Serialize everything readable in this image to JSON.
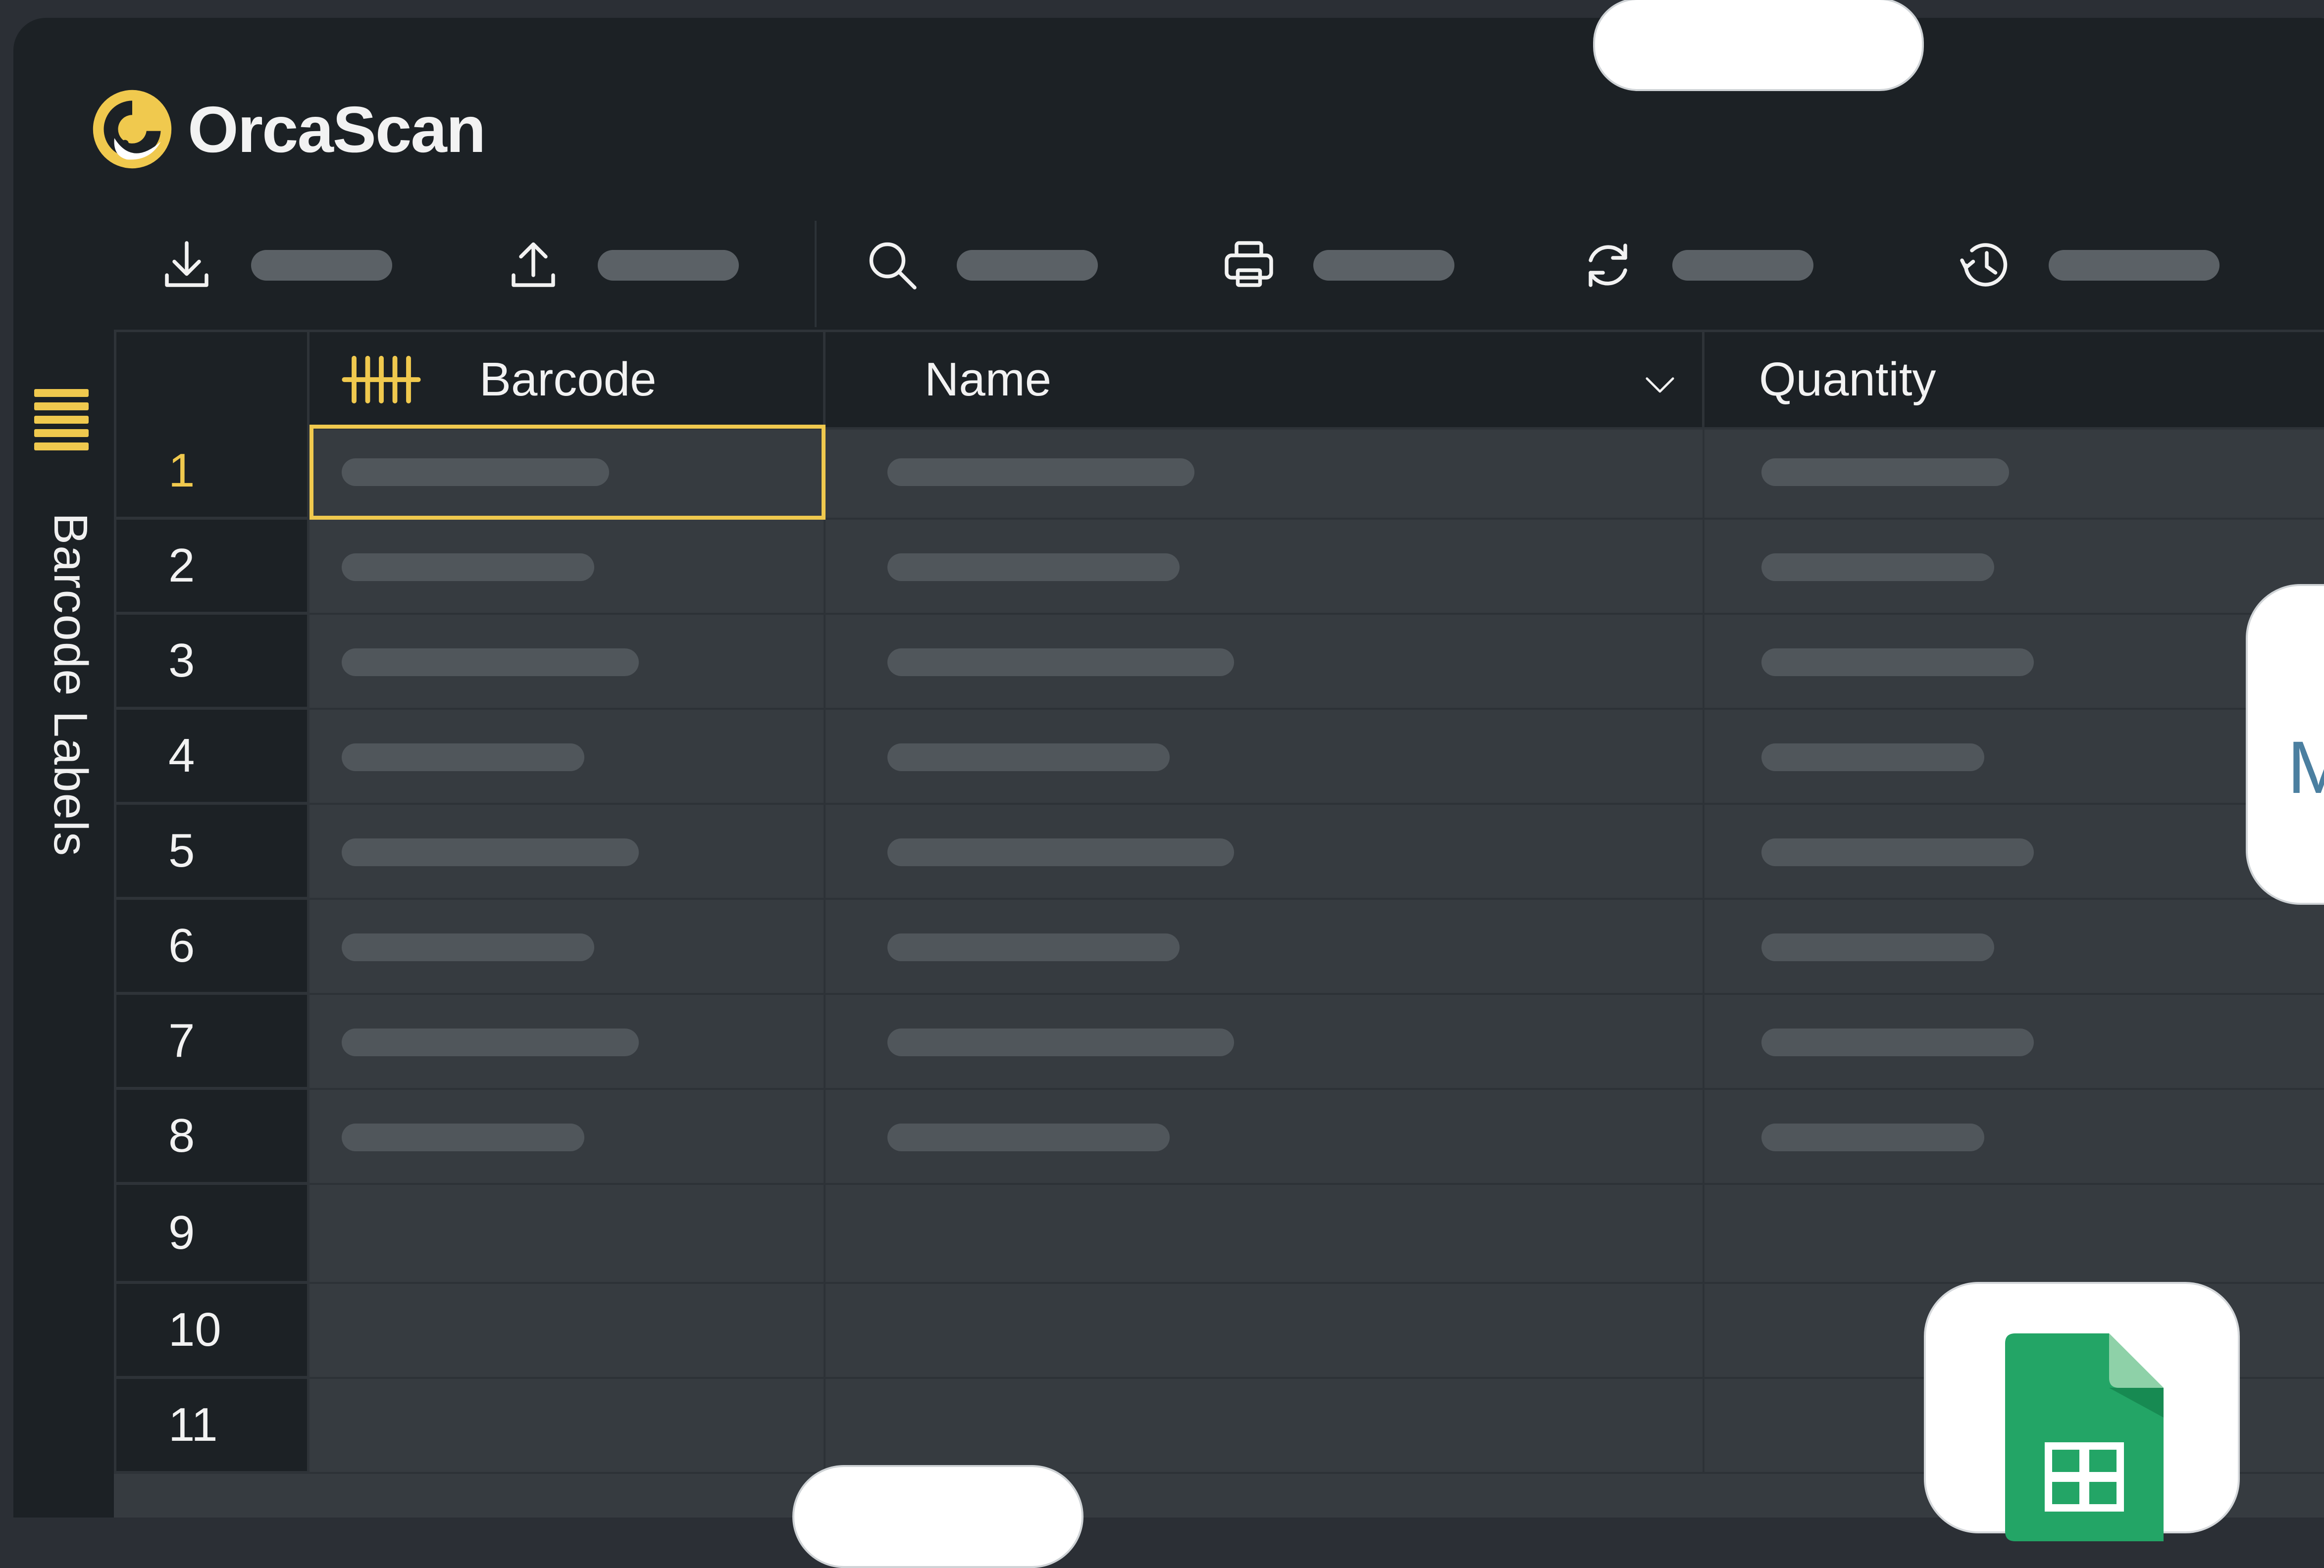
{
  "app": {
    "brand": "OrcaScan"
  },
  "toolbar": {
    "tools": [
      {
        "icon": "download-icon"
      },
      {
        "icon": "upload-icon"
      },
      {
        "icon": "search-icon"
      },
      {
        "icon": "print-icon"
      },
      {
        "icon": "refresh-icon"
      },
      {
        "icon": "history-icon"
      }
    ]
  },
  "sidebar": {
    "label": "Barcode Labels",
    "icon": "menu-lines-icon"
  },
  "grid": {
    "columns": [
      {
        "label": "Barcode",
        "icon": "barcode-icon"
      },
      {
        "label": "Name",
        "icon": "chevron-down-icon"
      },
      {
        "label": "Quantity"
      }
    ],
    "rows": [
      {
        "num": "1"
      },
      {
        "num": "2"
      },
      {
        "num": "3"
      },
      {
        "num": "4"
      },
      {
        "num": "5"
      },
      {
        "num": "6"
      },
      {
        "num": "7"
      },
      {
        "num": "8"
      },
      {
        "num": "9"
      },
      {
        "num": "10"
      },
      {
        "num": "11"
      }
    ],
    "selected_row": 1
  },
  "floating": {
    "right_card_text": "M",
    "sheets_icon": "google-sheets-icon"
  },
  "colors": {
    "accent": "#f0c94e",
    "background": "#1c2125",
    "cell": "#363b40",
    "sheets_green": "#23a566"
  }
}
